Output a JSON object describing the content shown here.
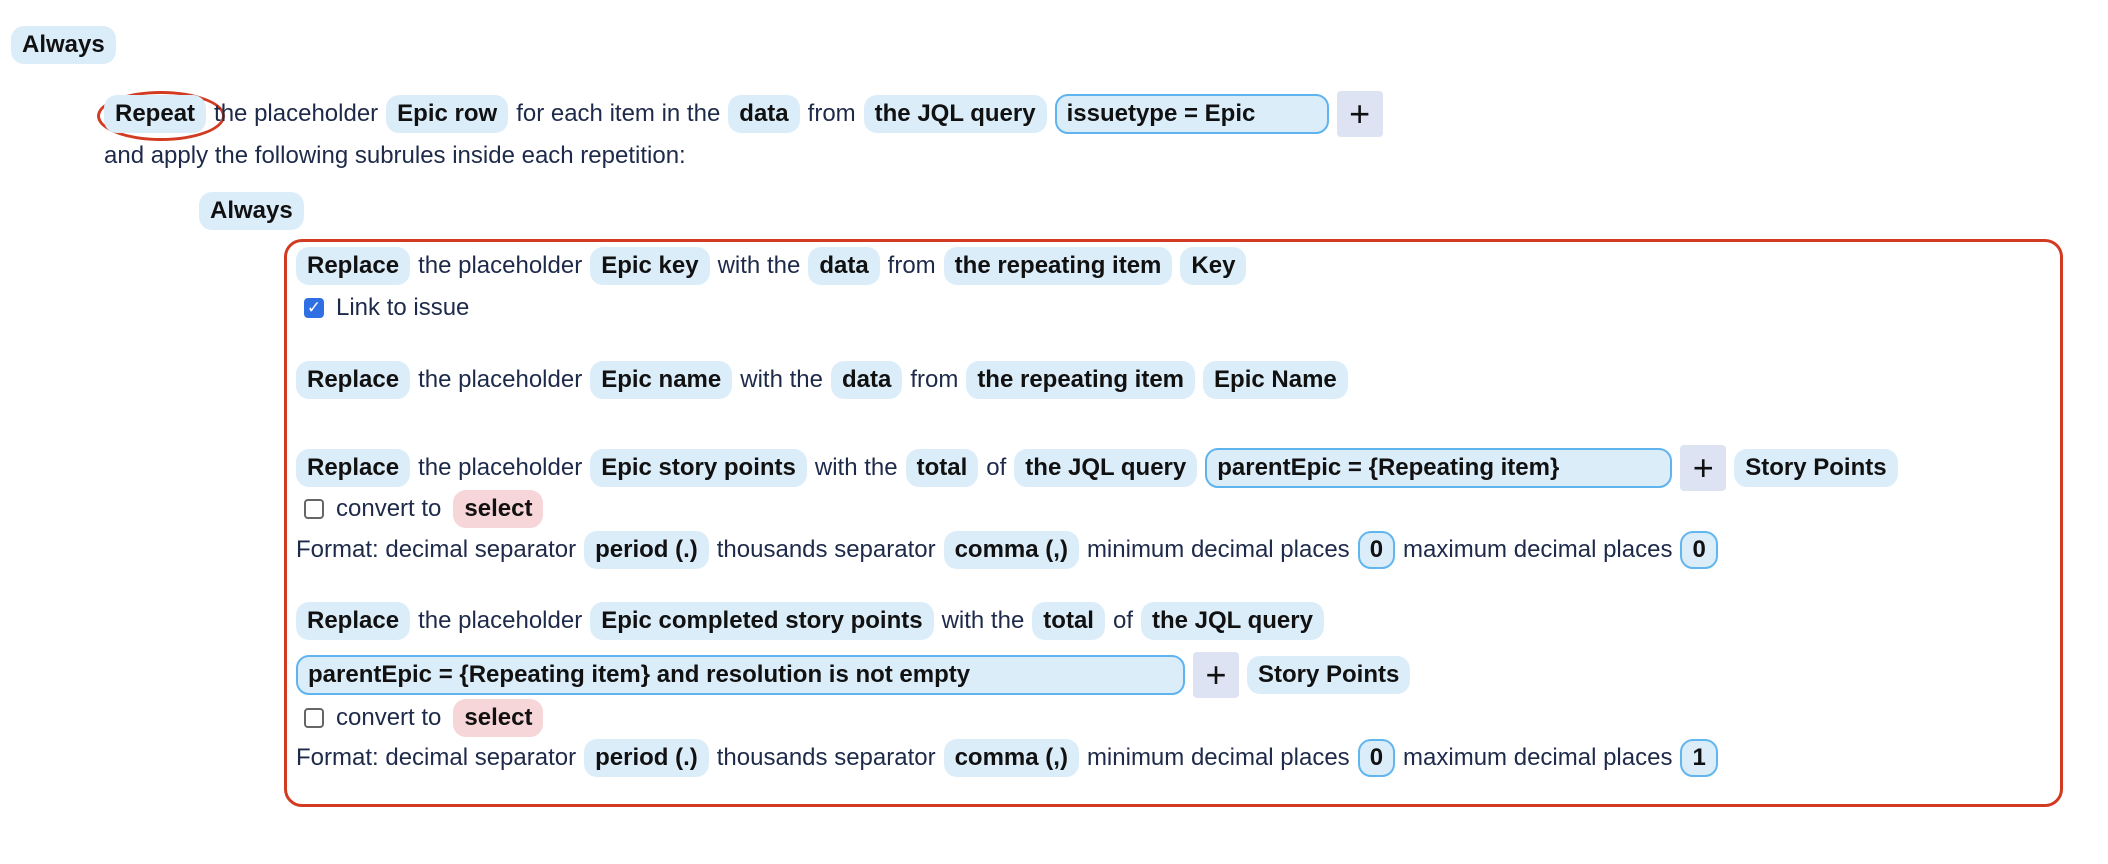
{
  "always_label": "Always",
  "repeat_rule": {
    "action": "Repeat",
    "t1": "the placeholder",
    "placeholder": "Epic row",
    "t2": "for each item in the",
    "source": "data",
    "t3": "from",
    "query_type": "the JQL query",
    "query": "issuetype = Epic",
    "add": "+",
    "line2": "and apply the following subrules inside each repetition:"
  },
  "subrules": [
    {
      "action": "Replace",
      "t1": "the placeholder",
      "placeholder": "Epic key",
      "t2": "with the",
      "source": "data",
      "t3": "from",
      "from": "the repeating item",
      "field": "Key",
      "link_label": "Link to issue",
      "link_checked": true
    },
    {
      "action": "Replace",
      "t1": "the placeholder",
      "placeholder": "Epic name",
      "t2": "with the",
      "source": "data",
      "t3": "from",
      "from": "the repeating item",
      "field": "Epic Name"
    },
    {
      "action": "Replace",
      "t1": "the placeholder",
      "placeholder": "Epic story points",
      "t2": "with the",
      "source": "total",
      "t3": "of",
      "from": "the JQL query",
      "query": "parentEpic = {Repeating item}",
      "add": "+",
      "field": "Story Points",
      "convert_label": "convert to",
      "convert_value": "select",
      "convert_checked": false,
      "format": {
        "l1": "Format: decimal separator",
        "decimal": "period (.)",
        "l2": "thousands separator",
        "thousands": "comma (,)",
        "l3": "minimum decimal places",
        "min": "0",
        "l4": "maximum decimal places",
        "max": "0"
      }
    },
    {
      "action": "Replace",
      "t1": "the placeholder",
      "placeholder": "Epic completed story points",
      "t2": "with the",
      "source": "total",
      "t3": "of",
      "from": "the JQL query",
      "query": "parentEpic = {Repeating item} and resolution is not empty",
      "add": "+",
      "field": "Story Points",
      "convert_label": "convert to",
      "convert_value": "select",
      "convert_checked": false,
      "format": {
        "l1": "Format: decimal separator",
        "decimal": "period (.)",
        "l2": "thousands separator",
        "thousands": "comma (,)",
        "l3": "minimum decimal places",
        "min": "0",
        "l4": "maximum decimal places",
        "max": "1"
      }
    }
  ],
  "colors": {
    "highlight": "#d23b22",
    "pill": "#dcedfa",
    "select_pill": "#f6d6d8"
  }
}
